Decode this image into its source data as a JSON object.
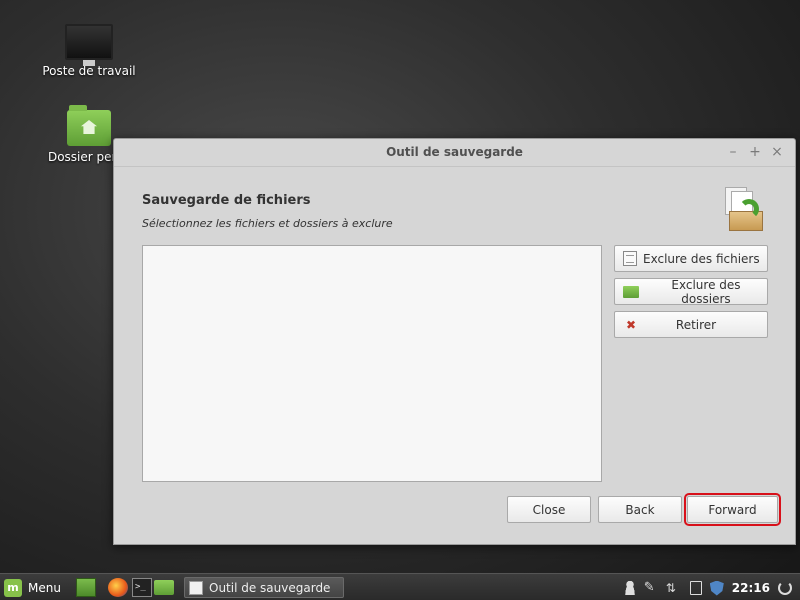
{
  "desktop": {
    "icons": [
      {
        "label": "Poste de travail",
        "icon": "computer-icon"
      },
      {
        "label": "Dossier perso",
        "icon": "home-folder-icon"
      }
    ]
  },
  "window": {
    "title": "Outil de sauvegarde",
    "controls": {
      "minimize": "–",
      "maximize": "+",
      "close": "×"
    },
    "heading": "Sauvegarde de fichiers",
    "subheading": "Sélectionnez les fichiers et dossiers à exclure",
    "exclusion_list": [],
    "side_buttons": {
      "exclude_files": "Exclure des fichiers",
      "exclude_folders": "Exclure des dossiers",
      "remove": "Retirer"
    },
    "nav_buttons": {
      "close": "Close",
      "back": "Back",
      "forward": "Forward"
    }
  },
  "panel": {
    "menu_label": "Menu",
    "task_label": "Outil de sauvegarde",
    "clock": "22:16",
    "terminal_glyph": ">_"
  },
  "colors": {
    "highlight_outline": "#d8101a",
    "mint_green": "#87c24a",
    "remove_x": "#c0392b"
  }
}
